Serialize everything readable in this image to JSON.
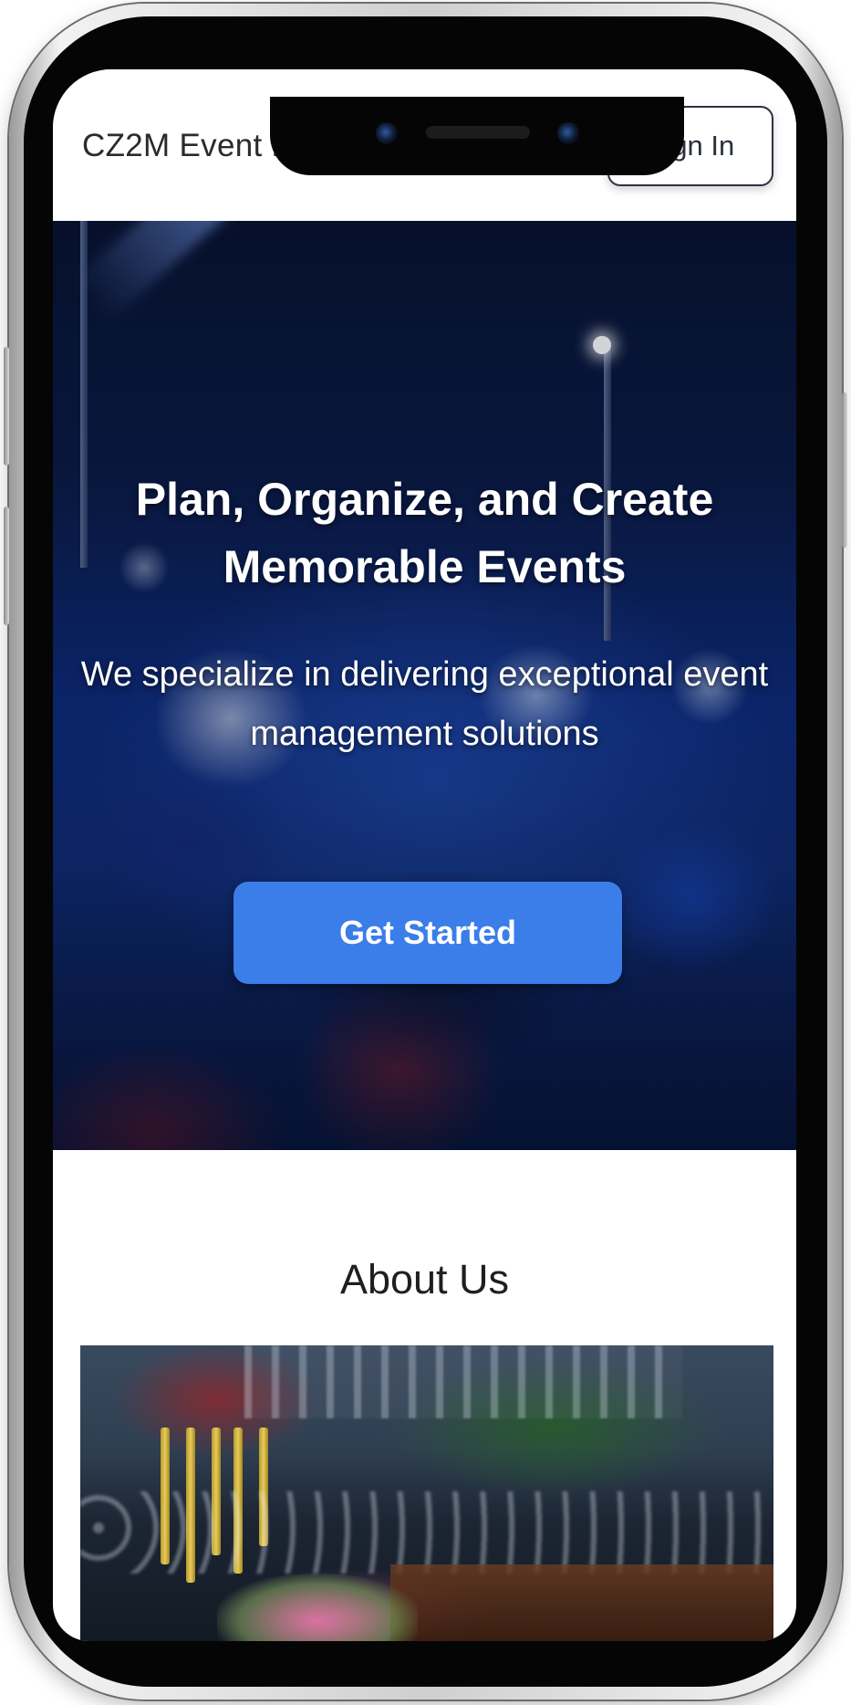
{
  "header": {
    "brand": "CZ2M Event Management",
    "sign_in_label": "Sign In"
  },
  "hero": {
    "title": "Plan, Organize, and Create Memorable Events",
    "subtitle": "We specialize in delivering exceptional event management solutions",
    "cta_label": "Get Started",
    "cta_color": "#3b7de9"
  },
  "about": {
    "title": "About Us"
  }
}
